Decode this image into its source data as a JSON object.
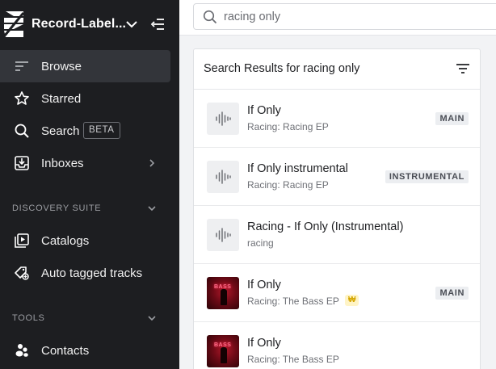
{
  "sidebar": {
    "brand_name": "Record-Label...",
    "nav": [
      {
        "label": "Browse",
        "icon": "browse-icon",
        "active": true
      },
      {
        "label": "Starred",
        "icon": "star-icon"
      },
      {
        "label": "Search",
        "icon": "search-icon",
        "badge": "BETA"
      },
      {
        "label": "Inboxes",
        "icon": "inbox-icon"
      }
    ],
    "discovery": {
      "title": "DISCOVERY SUITE",
      "items": [
        {
          "label": "Catalogs",
          "icon": "catalog-icon"
        },
        {
          "label": "Auto tagged tracks",
          "icon": "auto-tag-icon"
        }
      ]
    },
    "tools": {
      "title": "TOOLS",
      "items": [
        {
          "label": "Contacts",
          "icon": "contacts-icon"
        }
      ]
    }
  },
  "search": {
    "query": "racing only"
  },
  "results": {
    "title": "Search Results for racing only",
    "rows": [
      {
        "title": "If Only",
        "subtitle": "Racing: Racing EP",
        "tag": "MAIN",
        "artwork": "waveform"
      },
      {
        "title": "If Only instrumental",
        "subtitle": "Racing: Racing EP",
        "tag": "INSTRUMENTAL",
        "artwork": "waveform"
      },
      {
        "title": "Racing - If Only (Instrumental)",
        "subtitle": "racing",
        "tag": "",
        "artwork": "waveform"
      },
      {
        "title": "If Only",
        "subtitle": "Racing: The Bass EP",
        "tag": "MAIN",
        "artwork": "cover",
        "coin": "₩"
      },
      {
        "title": "If Only",
        "subtitle": "Racing: The Bass EP",
        "tag": "",
        "artwork": "cover"
      }
    ]
  },
  "colors": {
    "sidebar_bg": "#1d1e21",
    "sidebar_active": "#33353a",
    "main_bg": "#f2f3f5",
    "tag_bg": "#eceef1",
    "coin_gold": "#d4a600"
  }
}
